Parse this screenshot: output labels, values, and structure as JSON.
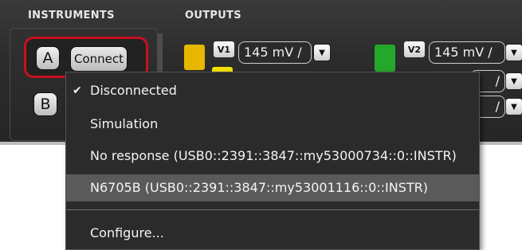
{
  "sections": {
    "instruments": "INSTRUMENTS",
    "outputs": "OUTPUTS"
  },
  "instruments": {
    "a_label": "A",
    "b_label": "B",
    "connect_label": "Connect"
  },
  "outputs": {
    "v1": {
      "badge": "V1",
      "scale": "145 mV /",
      "color": "#e8b800"
    },
    "v2": {
      "badge": "V2",
      "scale": "145 mV /",
      "color": "#24a82b"
    },
    "row2_scale": "/",
    "row3_scale": "/",
    "row2_color": "#f5e200"
  },
  "connection_menu": {
    "items": [
      {
        "label": "Disconnected",
        "checked": true
      },
      {
        "label": "Simulation",
        "checked": false
      },
      {
        "label": "No response (USB0::2391::3847::my53000734::0::INSTR)",
        "checked": false
      },
      {
        "label": "N6705B (USB0::2391::3847::my53001116::0::INSTR)",
        "checked": false,
        "highlighted": true
      },
      {
        "label": "Configure...",
        "checked": false
      }
    ],
    "check_glyph": "✔"
  }
}
